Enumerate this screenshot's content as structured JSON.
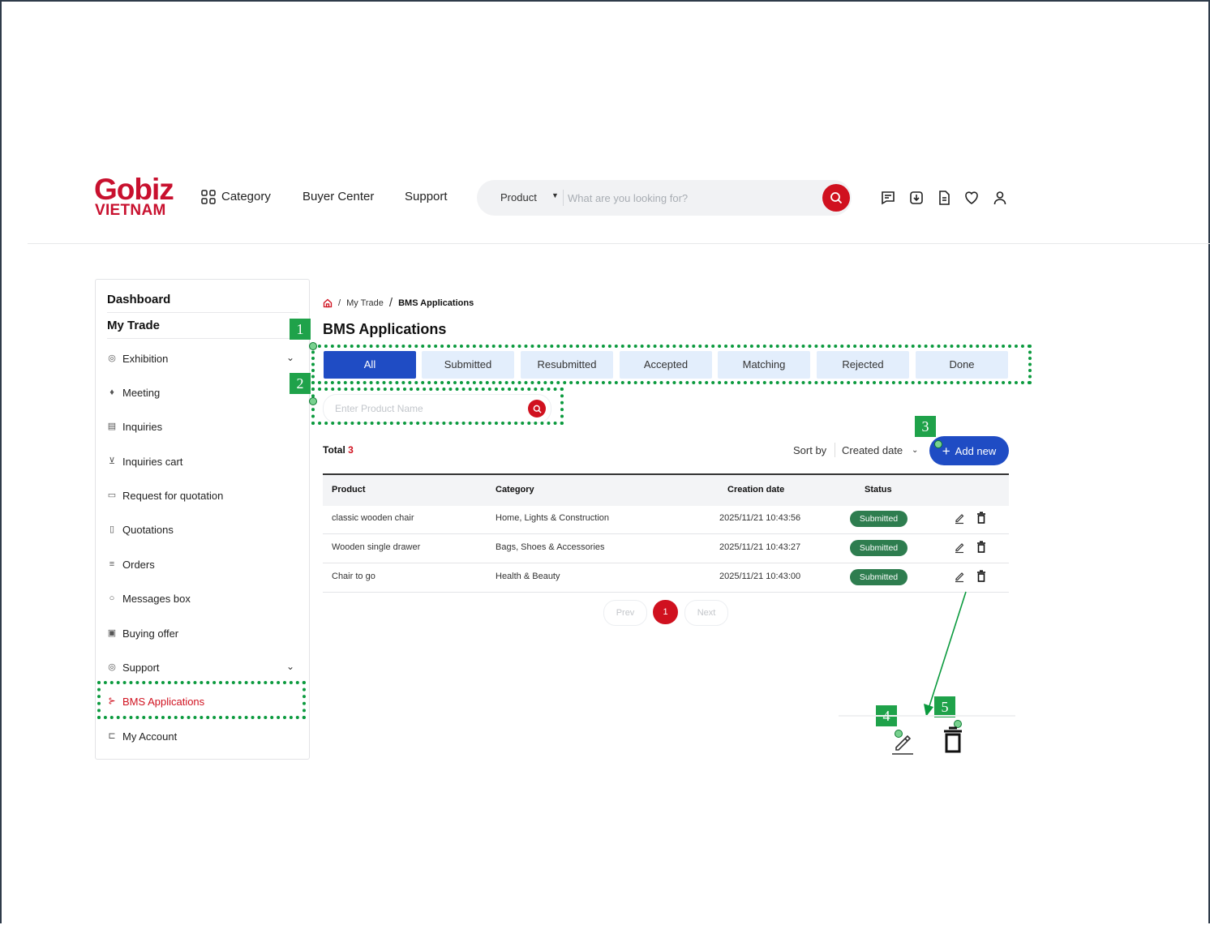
{
  "header": {
    "logo_top": "Gobiz",
    "logo_bottom": "VIETNAM",
    "nav": {
      "category": "Category",
      "buyer_center": "Buyer Center",
      "support": "Support"
    },
    "search": {
      "type": "Product",
      "placeholder": "What are you looking for?"
    },
    "icons": [
      "messages-icon",
      "download-icon",
      "document-icon",
      "heart-icon",
      "user-icon"
    ]
  },
  "sidebar": {
    "dashboard": "Dashboard",
    "my_trade": "My Trade",
    "items": [
      {
        "label": "Exhibition",
        "icon": "exhibition-icon"
      },
      {
        "label": "Meeting",
        "icon": "meeting-icon"
      },
      {
        "label": "Inquiries",
        "icon": "inquiries-icon"
      },
      {
        "label": "Inquiries cart",
        "icon": "cart-icon"
      },
      {
        "label": "Request for quotation",
        "icon": "rfq-icon"
      },
      {
        "label": "Quotations",
        "icon": "quotations-icon"
      },
      {
        "label": "Orders",
        "icon": "orders-icon"
      },
      {
        "label": "Messages box",
        "icon": "messages-icon"
      },
      {
        "label": "Buying offer",
        "icon": "buying-offer-icon"
      },
      {
        "label": "Support",
        "icon": "support-icon"
      },
      {
        "label": "BMS Applications",
        "icon": "bms-icon"
      },
      {
        "label": "My Account",
        "icon": "account-icon"
      }
    ]
  },
  "breadcrumb": {
    "sep": "/",
    "level1": "My Trade",
    "level2": "BMS Applications"
  },
  "page_title": "BMS Applications",
  "tabs": [
    "All",
    "Submitted",
    "Resubmitted",
    "Accepted",
    "Matching",
    "Rejected",
    "Done"
  ],
  "product_search": {
    "placeholder": "Enter Product Name"
  },
  "toolbar": {
    "total_label": "Total",
    "total_count": "3",
    "sort_label": "Sort by",
    "sort_value": "Created date",
    "add_new": "Add new"
  },
  "table": {
    "columns": [
      "Product",
      "Category",
      "Creation date",
      "Status"
    ],
    "rows": [
      {
        "product": "classic wooden chair",
        "category": "Home, Lights & Construction",
        "date": "2025/11/21 10:43:56",
        "status": "Submitted"
      },
      {
        "product": "Wooden single drawer",
        "category": "Bags, Shoes & Accessories",
        "date": "2025/11/21 10:43:27",
        "status": "Submitted"
      },
      {
        "product": "Chair to go",
        "category": "Health & Beauty",
        "date": "2025/11/21 10:43:00",
        "status": "Submitted"
      }
    ]
  },
  "pagination": {
    "prev": "Prev",
    "current": "1",
    "next": "Next"
  },
  "annotations": {
    "markers": [
      "1",
      "2",
      "3",
      "4",
      "5"
    ]
  },
  "colors": {
    "brand_red": "#d0111f",
    "primary_blue": "#1f4cc4",
    "tab_bg": "#e3eefc",
    "status_green": "#2e7d4f",
    "annotation_green": "#0b9a3e"
  }
}
